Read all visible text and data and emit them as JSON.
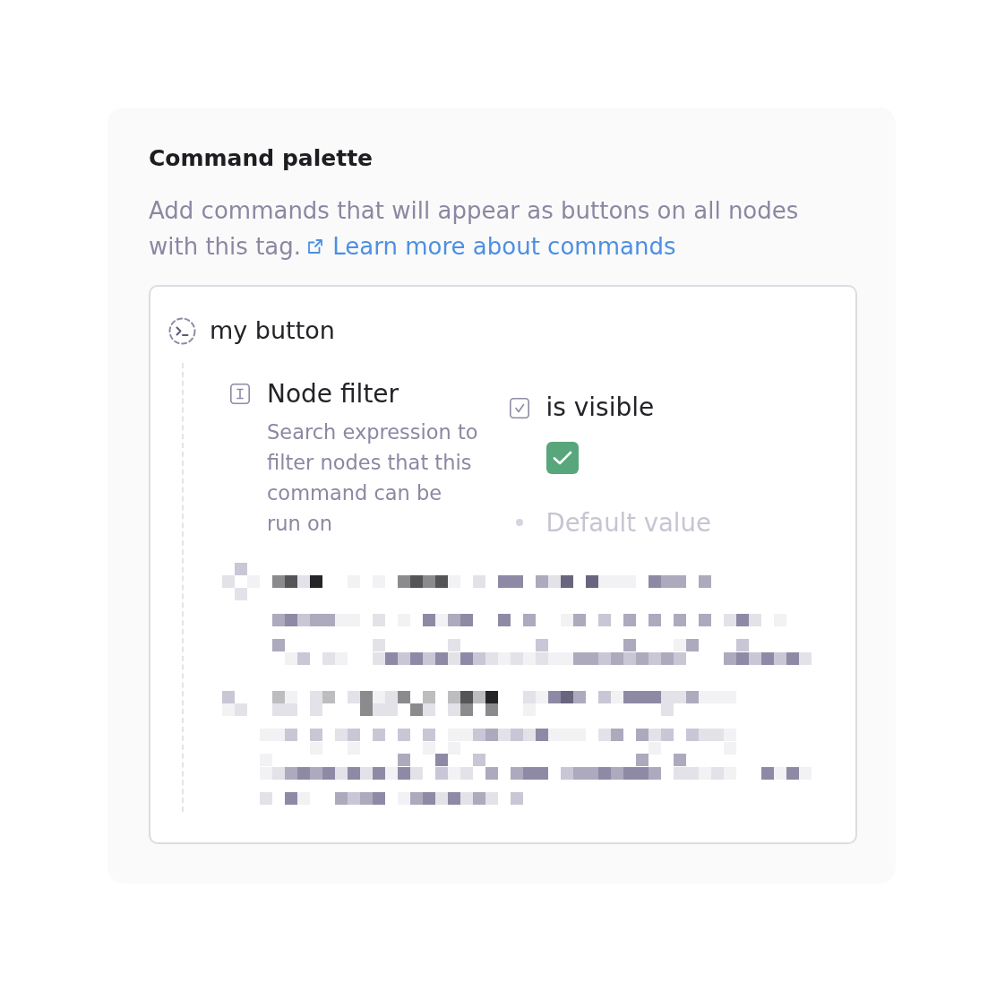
{
  "section": {
    "title": "Command palette",
    "description": "Add commands that will appear as buttons on all nodes with this tag.",
    "link": "Learn more about commands"
  },
  "commands": [
    {
      "name": "my button",
      "fields": [
        {
          "kind": "text",
          "label": "Node filter",
          "description": "Search expression to filter nodes that this command can be run on"
        },
        {
          "kind": "checkbox",
          "label": "is visible",
          "checked": true,
          "placeholder": "Default value"
        }
      ]
    }
  ]
}
